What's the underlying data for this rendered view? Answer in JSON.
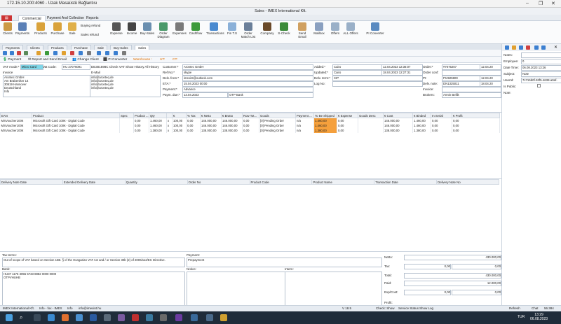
{
  "rdp": {
    "title": "172.15.10.200:4060 - Uzak Masaüstü Bağlantısı"
  },
  "app": {
    "title": "Sales - IMEX International Kft."
  },
  "ribbon_tabs": [
    "Commercial",
    "Payment And Collection",
    "Reports"
  ],
  "ribbon_buttons": [
    "Clients",
    "Payments",
    "Products",
    "Purchase",
    "Sale",
    "Buying refund",
    "Sales refund",
    "Expense",
    "Income",
    "Buy-Sales",
    "Order Diagram",
    "Expenses",
    "Cashflow",
    "Transactions",
    "Fin T.S",
    "Order Match List",
    "Company",
    "S-Check",
    "Send Email",
    "Mailbox",
    "Offers",
    "ALL Offers",
    "PI Converter"
  ],
  "doc_tabs": [
    "Payments",
    "Clients",
    "Products",
    "Purchase",
    "Sale",
    "Buy-Sales",
    "Sales"
  ],
  "actions": {
    "payment": "Payment",
    "report_email": "Report and Send Email",
    "change_client": "Change Client",
    "pi_converter": "PI Converter",
    "warehouse": "Warehouse :",
    "ut": "UT:",
    "ct": "CT:"
  },
  "form": {
    "vat_mode_label": "VAT mode:*",
    "vat_mode": "Micro Card",
    "vat_code_label": "Vat Code:",
    "vat_code": "HU 27076091",
    "company_line": "DE301598C Check VAT Show History All History",
    "email_label": "E-Mail",
    "email_values": [
      "info@aronteq.de",
      "info@aronteq.de",
      "info@aronteq.de",
      "info@aronteq.de"
    ],
    "invoice_label": "Invoice",
    "invoice_address": [
      "Arontec GmbH",
      "Am Brabeniker 14",
      "30519 Hannover",
      "Deutschland",
      "Info"
    ],
    "customer_label": "Customer:*",
    "customer": "Arontec GmbH",
    "refno_label": "Ref No:*",
    "refno": "skype",
    "delivery_from_label": "Delv. from:*",
    "delivery_from": "imexint@outlook.com",
    "eta_label": "ETA:*",
    "eta": "15.04.2023 00:00",
    "payment_label": "Payment:*",
    "payment": "Advance",
    "paym_due_label": "Paym. due:*",
    "paym_due": "13.04.2023",
    "bank": "OTP Bank",
    "added_label": "Added:*",
    "added": "Cairo",
    "added_date": "12.04.2023 12:36:07",
    "updated_label": "Updated:*",
    "updated": "Cairo",
    "updated_date": "18.04.2023 12:27:31",
    "delv_term_label": "Delv. term:*",
    "delv_term": "CIP",
    "log_label": "Log No:",
    "order_label": "Order:*",
    "order": "#7075207",
    "order_date": "12.04.20",
    "order_conf_label": "Order conf:",
    "pi_label": "PI:",
    "pi": "PI4925900",
    "pi_date": "12.04.20",
    "delv_note_label": "Delv. note:",
    "delv_note": "DN1325011",
    "delv_note_date": "18.04.20",
    "invoice_field_label": "Invoice:",
    "brokers_label": "Brokers:",
    "brokers": "Armin Bellik"
  },
  "grid": {
    "headers": [
      "EAN",
      "Product",
      "Spec",
      "Product ...",
      "Qty",
      "",
      "€",
      "% Tax",
      "€ Netto",
      "€ Brutto",
      "Row Tot...",
      "Goods",
      "Payment ...",
      "To Be Shipped",
      "€ Expense",
      "Goods Desc",
      "€ Cost",
      "€ Binded",
      "In Serial",
      "€ Profit"
    ],
    "rows": [
      [
        "MSVoucher100€",
        "Microsoft Gift Card 100€ - Digital Code",
        "",
        "0,00",
        "1.460,00",
        "x",
        "100,00",
        "0,00",
        "146.000,00",
        "146.000,00",
        "0,00",
        "[0] Pending Order",
        "n/a",
        "1.460,00",
        "0,00",
        "",
        "146.000,00",
        "1.460,00",
        "0,00",
        "0,00"
      ],
      [
        "MSVoucher100€",
        "Microsoft Gift Card 100€ - Digital Code",
        "",
        "0,00",
        "1.460,00",
        "x",
        "100,00",
        "0,00",
        "146.000,00",
        "146.000,00",
        "0,00",
        "[0] Pending Order",
        "n/a",
        "1.460,00",
        "0,00",
        "",
        "146.000,00",
        "1.460,00",
        "0,00",
        "0,00"
      ],
      [
        "MSVoucher100€",
        "Microsoft Gift Card 100€ - Digital Code",
        "",
        "0,00",
        "1.380,00",
        "x",
        "100,00",
        "0,00",
        "138.000,00",
        "138.000,00",
        "0,00",
        "[0] Pending Order",
        "n/a",
        "1.380,00",
        "0,00",
        "",
        "138.000,00",
        "1.380,00",
        "0,00",
        "0,00"
      ]
    ]
  },
  "delivery_grid": {
    "headers": [
      "Delivery Note Date",
      "Extended Delivery Date",
      "Quantity",
      "Order No",
      "Product Code",
      "Product Name",
      "Transaction Date",
      "Delivery Note No"
    ]
  },
  "bottom": {
    "tax_terms_label": "Tax terms:",
    "tax_terms": "Out of scope of VAT based on Section 16B. § of the Hungarian VAT Act and / or Section 30b (2) of 2006/112/EC Directive.",
    "payment_label": "Payment:",
    "payment": "Prepayment",
    "bank_label": "Bank:",
    "bank_lines": [
      "HU37 1176 3055 5733 8882 0000 0000",
      "OTPVHUHB"
    ],
    "notice_label": "Notice:",
    "intern_label": "Intern:",
    "netto_label": "Netto:",
    "netto": "430.000,00",
    "tax_label": "Tax:",
    "tax_a": "0,00",
    "tax_b": "0,00",
    "total_label": "Total:",
    "total": "430.000,00",
    "paid_label": "Paid:",
    "paid": "12.000,00",
    "exp_label": "Exp/Cost:",
    "exp_a": "0,00",
    "exp_b": "0,00",
    "profit_label": "Profit:"
  },
  "side": {
    "notes_label": "Notes:",
    "employee_label": "Employee:",
    "employee": "0",
    "datetime_label": "Date Time:",
    "datetime": "06.08.2023 13:26",
    "subject_label": "Subject:",
    "subject": "Note",
    "userid_label": "UserId:",
    "userid": "7c715b0f-93f5-4638-a0af-",
    "ispublic_label": "Is Public:",
    "note_label": "Note:"
  },
  "status": {
    "left": "IMEX International Kft.",
    "mid1": "Info - fox - IMEX",
    "mid2": "Info",
    "mid3": "info@imexint.hu",
    "version": "V 18.5",
    "check": "Check: Show",
    "service": "Service Status",
    "show_log": "Show Log",
    "refresh": "Refresh",
    "chat": "Chat",
    "chat_count": "56.384"
  },
  "taskbar": {
    "time": "13:29",
    "date": "06.08.2023",
    "lang": "TUR"
  }
}
